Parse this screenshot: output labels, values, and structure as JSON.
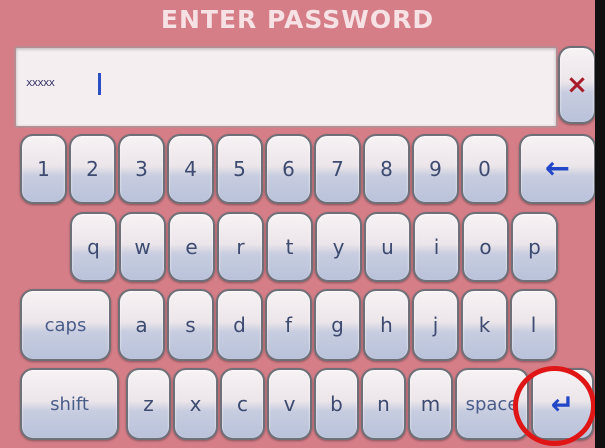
{
  "title": "ENTER PASSWORD",
  "password": {
    "masked_value": "xxxxx"
  },
  "clear_button": {
    "icon": "close-icon",
    "label": "×"
  },
  "keyboard": {
    "row_numbers": [
      "1",
      "2",
      "3",
      "4",
      "5",
      "6",
      "7",
      "8",
      "9",
      "0"
    ],
    "backspace": {
      "icon": "backspace-arrow-icon",
      "label": "←"
    },
    "row_top": [
      "q",
      "w",
      "e",
      "r",
      "t",
      "y",
      "u",
      "i",
      "o",
      "p"
    ],
    "row_middle": [
      "a",
      "s",
      "d",
      "f",
      "g",
      "h",
      "j",
      "k",
      "l"
    ],
    "row_bottom": [
      "z",
      "x",
      "c",
      "v",
      "b",
      "n",
      "m"
    ],
    "caps_label": "caps",
    "shift_label": "shift",
    "space_label": "space",
    "enter": {
      "icon": "enter-return-icon",
      "label": "↵"
    }
  },
  "colors": {
    "background": "#d57e88",
    "key_text": "#3d4b70",
    "accent_arrow": "#2246c8",
    "clear_x": "#a81c2a",
    "highlight": "#e01616"
  }
}
